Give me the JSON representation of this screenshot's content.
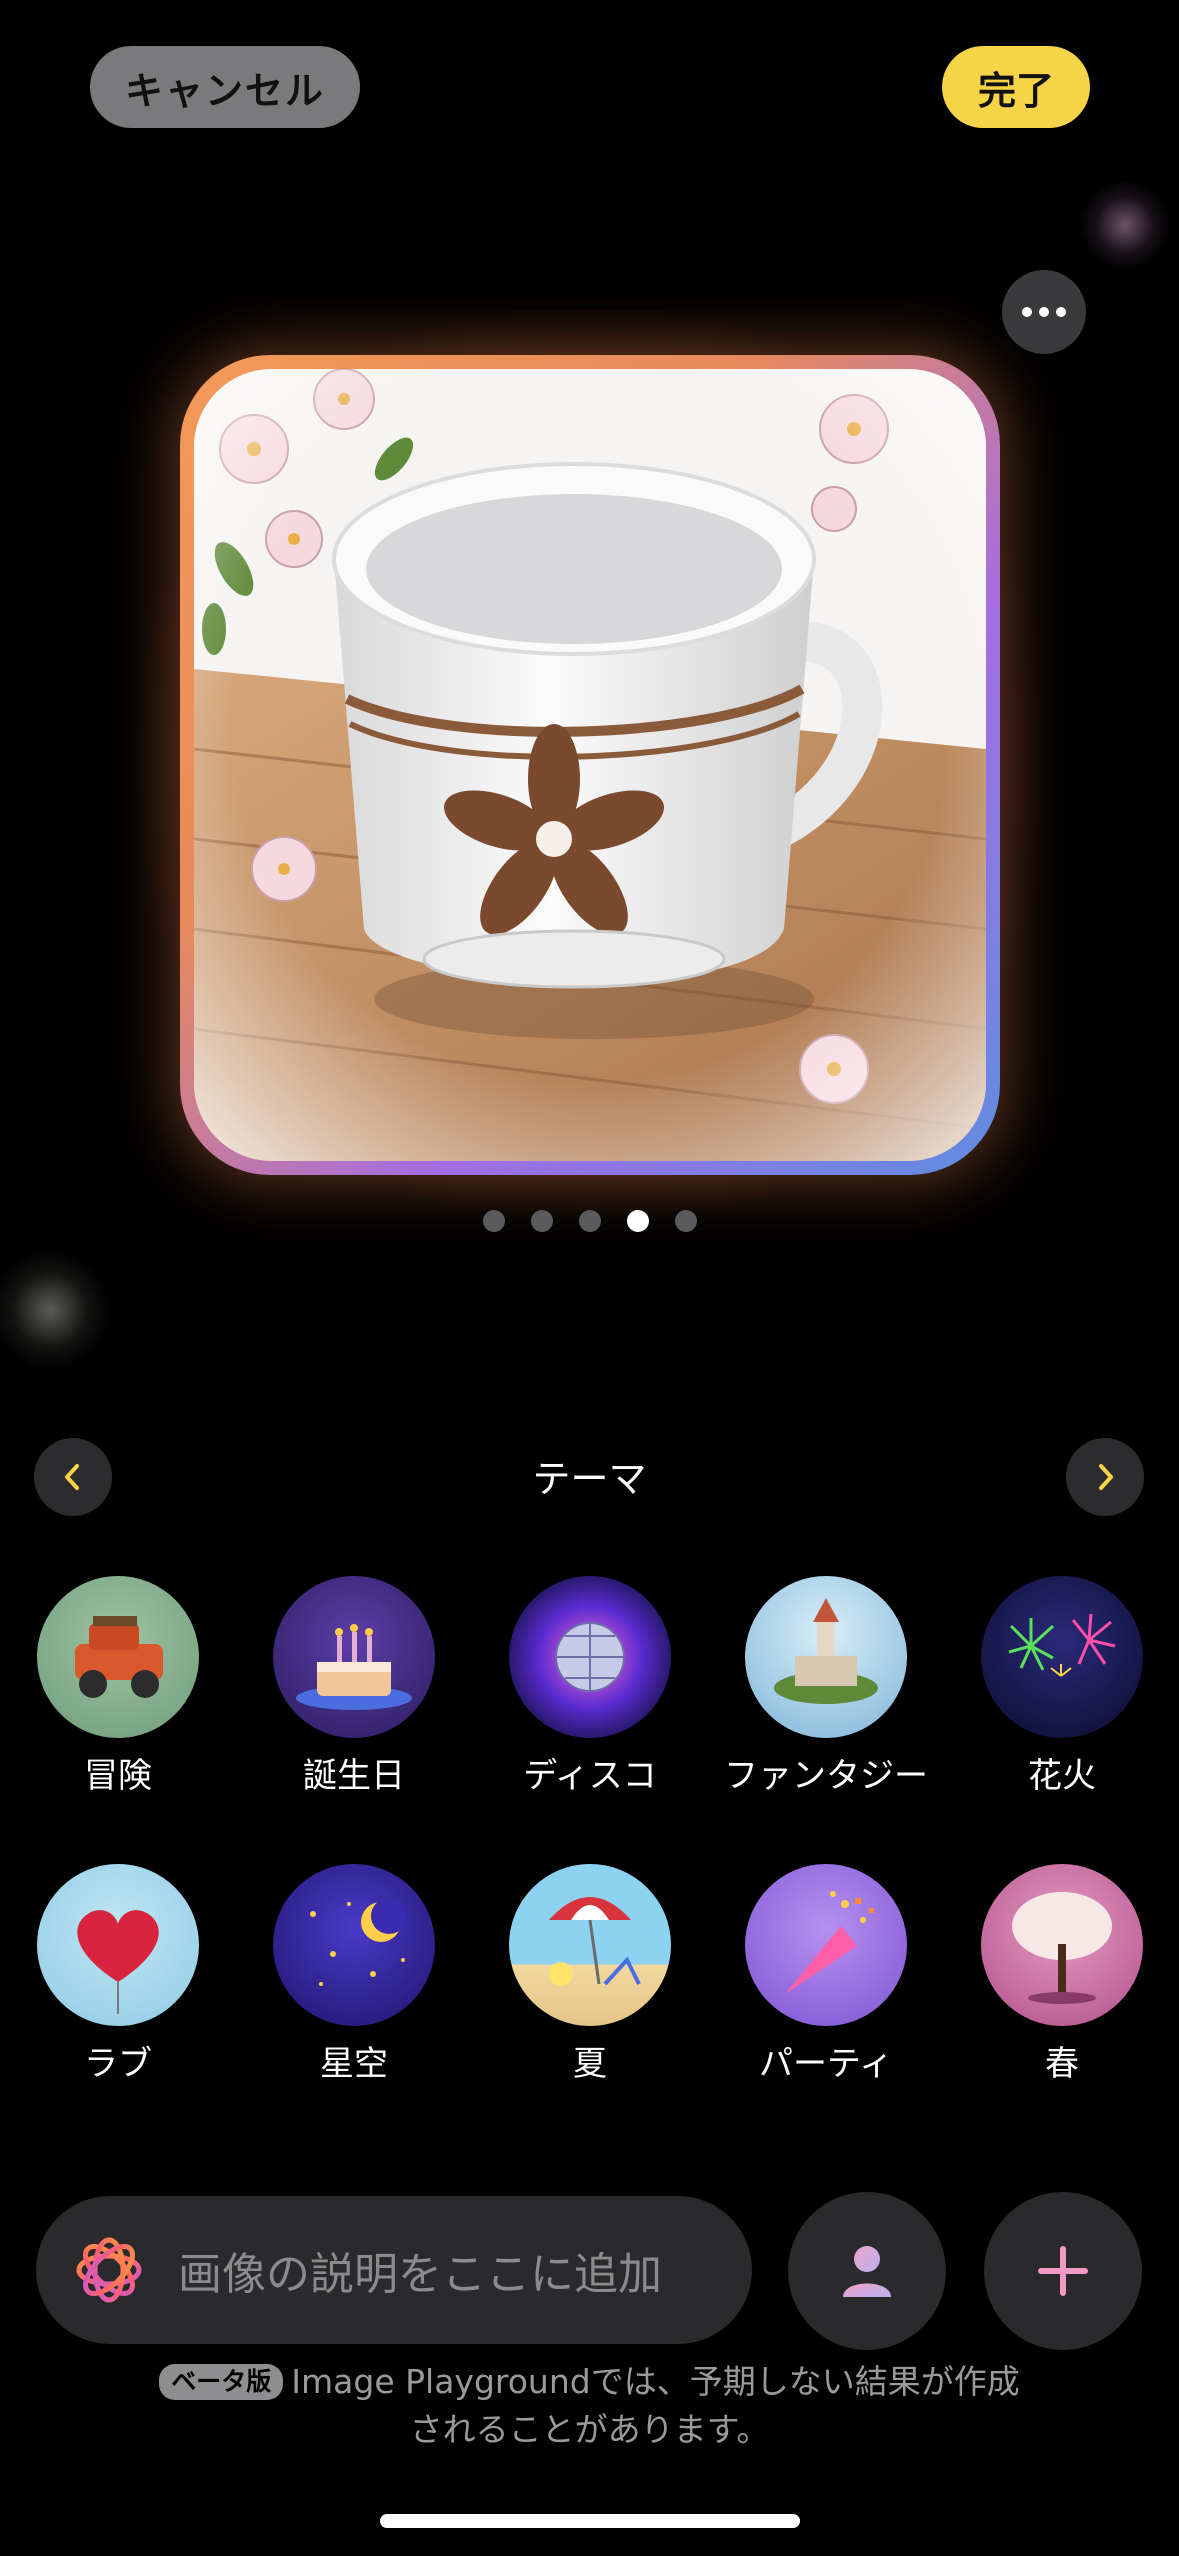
{
  "header": {
    "cancel_label": "キャンセル",
    "done_label": "完了"
  },
  "preview": {
    "page_count": 5,
    "current_page": 4
  },
  "themes": {
    "title": "テーマ",
    "row1": [
      {
        "label": "冒険",
        "icon": "adventure-jeep"
      },
      {
        "label": "誕生日",
        "icon": "birthday-cake"
      },
      {
        "label": "ディスコ",
        "icon": "disco-ball"
      },
      {
        "label": "ファンタジー",
        "icon": "fantasy-castle"
      },
      {
        "label": "花火",
        "icon": "fireworks"
      }
    ],
    "row2": [
      {
        "label": "ラブ",
        "icon": "heart-balloon"
      },
      {
        "label": "星空",
        "icon": "starry-moon"
      },
      {
        "label": "夏",
        "icon": "beach-umbrella"
      },
      {
        "label": "パーティ",
        "icon": "party-popper"
      },
      {
        "label": "春",
        "icon": "blossom-tree"
      }
    ]
  },
  "prompt": {
    "placeholder": "画像の説明をここに追加"
  },
  "footer": {
    "badge": "ベータ版",
    "line1": "Image Playgroundでは、予期しない結果が作成",
    "line2": "されることがあります。"
  },
  "colors": {
    "accent_yellow": "#f7d447",
    "background": "#000000",
    "control_gray": "#2a2a2c"
  }
}
